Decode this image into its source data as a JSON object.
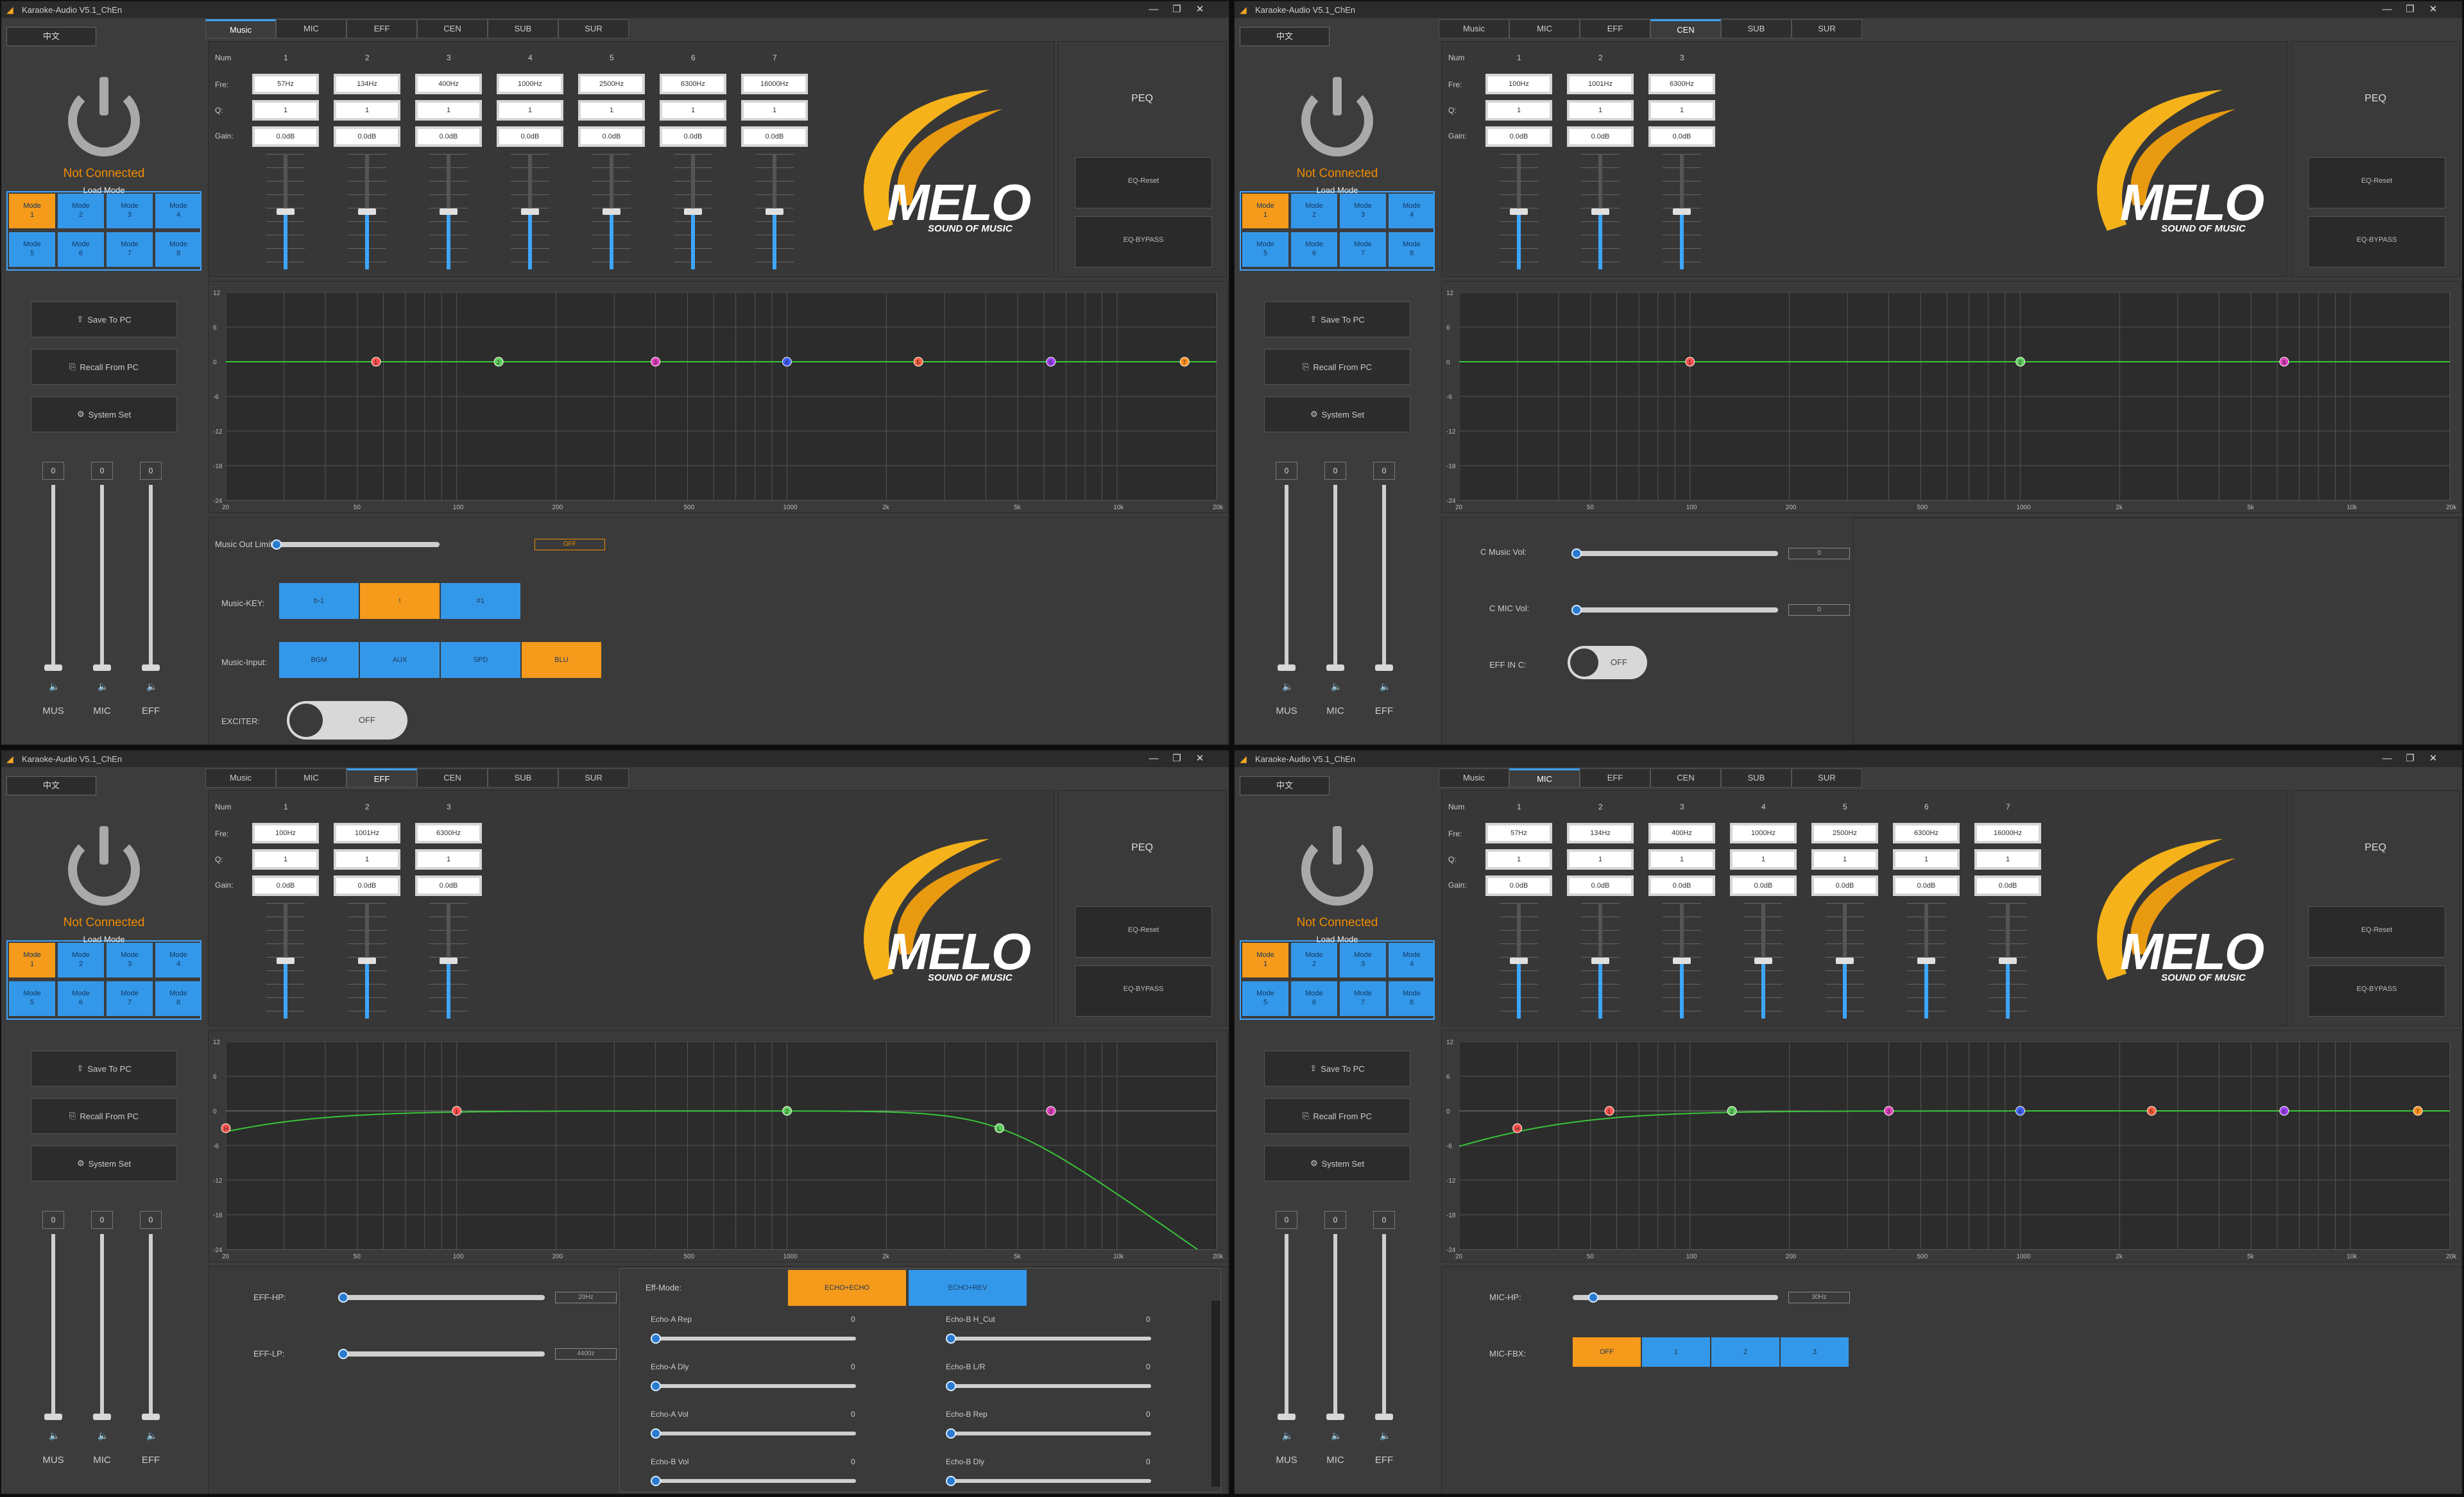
{
  "app": {
    "title": "Karaoke-Audio V5.1_ChEn",
    "lang_button": "中文",
    "status": "Not Connected",
    "load_mode_label": "Load Mode",
    "modes": [
      "Mode\n1",
      "Mode\n2",
      "Mode\n3",
      "Mode\n4",
      "Mode\n5",
      "Mode\n6",
      "Mode\n7",
      "Mode\n8"
    ],
    "save_label": "Save To PC",
    "recall_label": "Recall From PC",
    "system_label": "System Set",
    "vol_values": [
      "0",
      "0",
      "0"
    ],
    "vol_labels": [
      "MUS",
      "MIC",
      "EFF"
    ],
    "peq_title": "PEQ",
    "eq_reset": "EQ-Reset",
    "eq_bypass": "EQ-BYPASS",
    "logo_text": "MELO",
    "logo_sub": "SOUND OF MUSIC",
    "row_labels": [
      "Num",
      "Fre:",
      "Q:",
      "Gain:"
    ],
    "tabs": [
      "Music",
      "MIC",
      "EFF",
      "CEN",
      "SUB",
      "SUR"
    ],
    "x_ticks": [
      "20",
      "50",
      "100",
      "200",
      "500",
      "1000",
      "2k",
      "5k",
      "10k",
      "20k"
    ],
    "y_ticks": [
      "12",
      "6",
      "0",
      "-6",
      "-12",
      "-18",
      "-24"
    ]
  },
  "windows": [
    {
      "active_tab": 0,
      "bands": [
        {
          "n": "1",
          "f": "57Hz",
          "q": "1",
          "g": "0.0dB"
        },
        {
          "n": "2",
          "f": "134Hz",
          "q": "1",
          "g": "0.0dB"
        },
        {
          "n": "3",
          "f": "400Hz",
          "q": "1",
          "g": "0.0dB"
        },
        {
          "n": "4",
          "f": "1000Hz",
          "q": "1",
          "g": "0.0dB"
        },
        {
          "n": "5",
          "f": "2500Hz",
          "q": "1",
          "g": "0.0dB"
        },
        {
          "n": "6",
          "f": "6300Hz",
          "q": "1",
          "g": "0.0dB"
        },
        {
          "n": "7",
          "f": "16000Hz",
          "q": "1",
          "g": "0.0dB"
        }
      ],
      "curve": "flat",
      "points": [
        {
          "f": 57,
          "g": 0,
          "c": "#ff5050",
          "l": "1"
        },
        {
          "f": 134,
          "g": 0,
          "c": "#60d060",
          "l": "2"
        },
        {
          "f": 400,
          "g": 0,
          "c": "#e040c0",
          "l": "3"
        },
        {
          "f": 1000,
          "g": 0,
          "c": "#4060ff",
          "l": "4"
        },
        {
          "f": 2500,
          "g": 0,
          "c": "#ff6040",
          "l": "5"
        },
        {
          "f": 6300,
          "g": 0,
          "c": "#a040ff",
          "l": "6"
        },
        {
          "f": 16000,
          "g": 0,
          "c": "#ff9020",
          "l": "7"
        }
      ],
      "bottom": {
        "limit_label": "Music Out Limit:",
        "limit_value": "OFF",
        "key_label": "Music-KEY:",
        "keys": [
          "b-1",
          "♮",
          "#1"
        ],
        "key_active": 1,
        "input_label": "Music-Input:",
        "inputs": [
          "BGM",
          "AUX",
          "SPD",
          "BLU"
        ],
        "input_active": 3,
        "exciter_label": "EXCITER:",
        "exciter_value": "OFF"
      }
    },
    {
      "active_tab": 3,
      "bands": [
        {
          "n": "1",
          "f": "100Hz",
          "q": "1",
          "g": "0.0dB"
        },
        {
          "n": "2",
          "f": "1001Hz",
          "q": "1",
          "g": "0.0dB"
        },
        {
          "n": "3",
          "f": "6300Hz",
          "q": "1",
          "g": "0.0dB"
        }
      ],
      "curve": "flat",
      "points": [
        {
          "f": 100,
          "g": 0,
          "c": "#ff5050",
          "l": "1"
        },
        {
          "f": 1001,
          "g": 0,
          "c": "#60d060",
          "l": "2"
        },
        {
          "f": 6300,
          "g": 0,
          "c": "#e040c0",
          "l": "3"
        }
      ],
      "bottom": {
        "cmusic_label": "C Music Vol:",
        "cmusic_value": "0",
        "cmic_label": "C MIC Vol:",
        "cmic_value": "0",
        "effin_label": "EFF IN C:",
        "effin_value": "OFF"
      }
    },
    {
      "active_tab": 2,
      "bands": [
        {
          "n": "1",
          "f": "100Hz",
          "q": "1",
          "g": "0.0dB"
        },
        {
          "n": "2",
          "f": "1001Hz",
          "q": "1",
          "g": "0.0dB"
        },
        {
          "n": "3",
          "f": "6300Hz",
          "q": "1",
          "g": "0.0dB"
        }
      ],
      "curve": "hplp",
      "hp": 20,
      "lp": 4400,
      "points": [
        {
          "f": 20,
          "g": -3,
          "c": "#ff5050",
          "l": "H"
        },
        {
          "f": 100,
          "g": 0,
          "c": "#ff5050",
          "l": "1"
        },
        {
          "f": 1001,
          "g": 0,
          "c": "#60d060",
          "l": "2"
        },
        {
          "f": 6300,
          "g": 0,
          "c": "#e040c0",
          "l": "3"
        },
        {
          "f": 4400,
          "g": -3,
          "c": "#60d060",
          "l": "L"
        }
      ],
      "bottom": {
        "hp_label": "EFF-HP:",
        "hp_value": "20Hz",
        "lp_label": "EFF-LP:",
        "lp_value": "4400z",
        "mode_label": "Eff-Mode:",
        "modes": [
          "ECHO+ECHO",
          "ECHO+REV"
        ],
        "mode_active": 0,
        "echo": [
          {
            "l": "Echo-A Rep",
            "v": "0"
          },
          {
            "l": "Echo-B H_Cut",
            "v": "0"
          },
          {
            "l": "Echo-A Dly",
            "v": "0"
          },
          {
            "l": "Echo-B L/R",
            "v": "0"
          },
          {
            "l": "Echo-A Vol",
            "v": "0"
          },
          {
            "l": "Echo-B Rep",
            "v": "0"
          },
          {
            "l": "Echo-B Vol",
            "v": "0"
          },
          {
            "l": "Echo-B Dly",
            "v": "0"
          }
        ]
      }
    },
    {
      "active_tab": 1,
      "bands": [
        {
          "n": "1",
          "f": "57Hz",
          "q": "1",
          "g": "0.0dB"
        },
        {
          "n": "2",
          "f": "134Hz",
          "q": "1",
          "g": "0.0dB"
        },
        {
          "n": "3",
          "f": "400Hz",
          "q": "1",
          "g": "0.0dB"
        },
        {
          "n": "4",
          "f": "1000Hz",
          "q": "1",
          "g": "0.0dB"
        },
        {
          "n": "5",
          "f": "2500Hz",
          "q": "1",
          "g": "0.0dB"
        },
        {
          "n": "6",
          "f": "6300Hz",
          "q": "1",
          "g": "0.0dB"
        },
        {
          "n": "7",
          "f": "16000Hz",
          "q": "1",
          "g": "0.0dB"
        }
      ],
      "curve": "hp",
      "hp": 30,
      "points": [
        {
          "f": 30,
          "g": -3,
          "c": "#ff5050",
          "l": "H"
        },
        {
          "f": 57,
          "g": 0,
          "c": "#ff5050",
          "l": "1"
        },
        {
          "f": 134,
          "g": 0,
          "c": "#60d060",
          "l": "2"
        },
        {
          "f": 400,
          "g": 0,
          "c": "#e040c0",
          "l": "3"
        },
        {
          "f": 1000,
          "g": 0,
          "c": "#4060ff",
          "l": "4"
        },
        {
          "f": 2500,
          "g": 0,
          "c": "#ff6040",
          "l": "5"
        },
        {
          "f": 6300,
          "g": 0,
          "c": "#a040ff",
          "l": "6"
        },
        {
          "f": 16000,
          "g": 0,
          "c": "#ff9020",
          "l": "7"
        }
      ],
      "bottom": {
        "hp_label": "MIC-HP:",
        "hp_value": "30Hz",
        "fbx_label": "MIC-FBX:",
        "fbx": [
          "OFF",
          "1",
          "2",
          "3"
        ],
        "fbx_active": 0
      }
    }
  ]
}
